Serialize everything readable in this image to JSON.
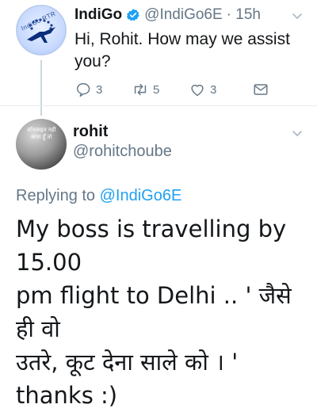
{
  "tweet1": {
    "name": "IndiGo",
    "handle": "@IndiGo6E",
    "time": "· 15h",
    "avatar_text": "IndiGo RTR",
    "text": "Hi, Rohit. How may we assist you?",
    "reply_count": "3",
    "retweet_count": "5",
    "like_count": "3",
    "verified": true
  },
  "tweet2": {
    "name": "rohit",
    "handle": "@rohitchoube",
    "avatar_text": "ऑनलाइन नहीं आता हूँ तो",
    "replying_prefix": "Replying to",
    "replying_handle": "@IndiGo6E",
    "text_line1": "My boss is travelling by 15.00",
    "text_line2": "pm flight to Delhi .. ' जैसे ही वो",
    "text_line3": "उतरे, कूट देना साले को । '",
    "text_line4": "thanks :)"
  },
  "colors": {
    "accent": "#1da1f2",
    "muted": "#657786",
    "text": "#14171a",
    "divider": "#e6ecf0"
  }
}
